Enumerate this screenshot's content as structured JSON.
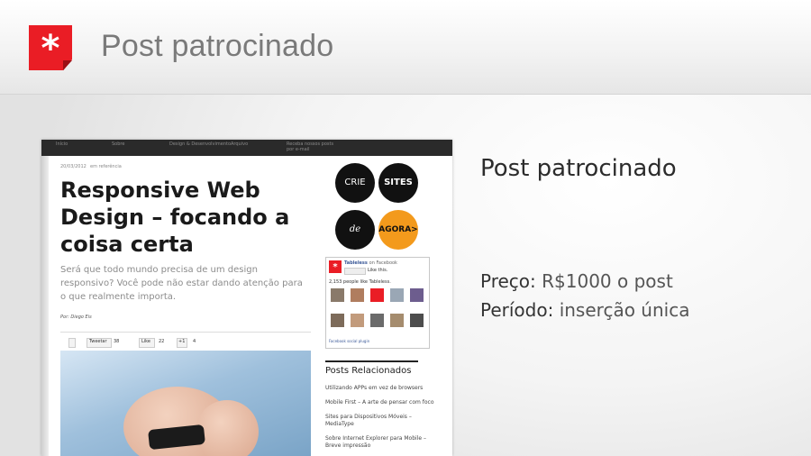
{
  "header": {
    "title": "Post patrocinado",
    "logo_glyph": "*",
    "logo_color": "#ea1d25"
  },
  "screenshot": {
    "nav_items": [
      "Início",
      "Sobre",
      "Design & Desenvolvimento",
      "Arquivo",
      "Receba nossos posts por e-mail"
    ],
    "meta_date": "20/03/2012",
    "meta_category": "em referência",
    "headline": "Responsive Web Design – focando a coisa certa",
    "lead": "Será que todo mundo precisa de um design responsivo? Você pode não estar dando atenção para o que realmente importa.",
    "byline": "Por: Diego Eis",
    "share": {
      "tweet_label": "Tweetar",
      "tweet_count": "38",
      "fb_label": "Like",
      "fb_count": "22",
      "gplus_label": "+1",
      "gplus_count": "4"
    },
    "ad": {
      "crie": "CRIE",
      "sites": "SITES",
      "de_graca": "de graça",
      "agora": "AGORA>"
    },
    "facebook_box": {
      "page_name": "Tableless",
      "page_sub": "on Facebook",
      "like_text": "Like this.",
      "count_text": "2,153 people like Tableless.",
      "footer": "Facebook social plugin"
    },
    "related": {
      "title": "Posts Relacionados",
      "links": [
        "Utilizando APPs em vez de browsers",
        "Mobile First – A arte de pensar com foco",
        "Sites para Dispositivos Móveis – MediaType",
        "Sobre Internet Explorer para Mobile – Breve impressão"
      ]
    }
  },
  "info": {
    "title": "Post patrocinado",
    "price_label": "Preço:",
    "price_value": "R$1000 o post",
    "period_label": "Período:",
    "period_value": "inserção única"
  },
  "colors": {
    "brand_red": "#ea1d25",
    "ad_orange": "#f39a1c",
    "facebook_blue": "#3b5998"
  }
}
